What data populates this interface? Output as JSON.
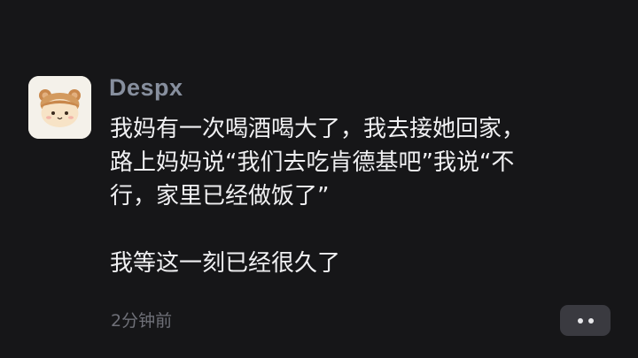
{
  "post": {
    "username": "Despx",
    "avatar_icon": "bear-hat-avatar",
    "text_lines": [
      "我妈有一次喝酒喝大了，我去接她回家，",
      "路上妈妈说“我们去吃肯德基吧”我说“不",
      "行，家里已经做饭了”",
      "",
      "我等这一刻已经很久了"
    ],
    "timestamp": "2分钟前",
    "more_icon": "more-dots-icon"
  },
  "colors": {
    "background": "#161618",
    "username": "#878f9e",
    "text": "#f0f0f2",
    "timestamp": "#6f7078",
    "more_button": "#3a3a40"
  }
}
